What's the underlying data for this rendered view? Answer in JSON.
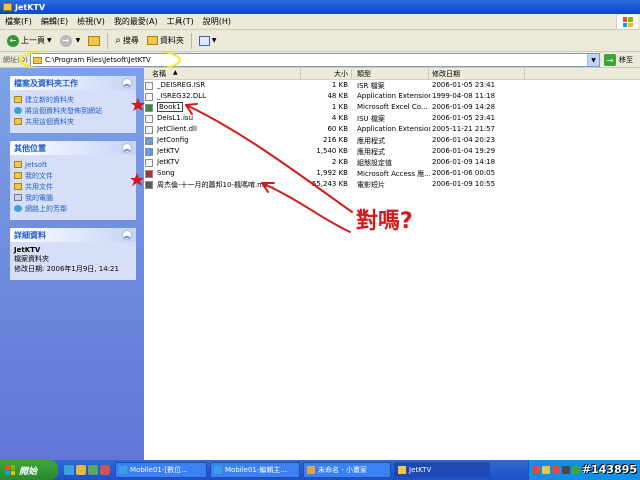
{
  "window": {
    "title": "JetKTV"
  },
  "menu": [
    "檔案(F)",
    "編輯(E)",
    "檢視(V)",
    "我的最愛(A)",
    "工具(T)",
    "說明(H)"
  ],
  "toolbar": {
    "back_label": "上一頁",
    "search_label": "搜尋",
    "folders_label": "資料夾"
  },
  "address": {
    "label": "網址(D)",
    "path": "C:\\Program Files\\Jetsoft\\JetKTV",
    "go_label": "移至"
  },
  "tasks_panel": {
    "title": "檔案及資料夾工作",
    "items": [
      "建立新的資料夾",
      "將這個資料夾發佈到網站",
      "共用這個資料夾"
    ]
  },
  "places_panel": {
    "title": "其他位置",
    "items": [
      "Jetsoft",
      "我的文件",
      "共用文件",
      "我的電腦",
      "網路上的芳鄰"
    ]
  },
  "details_panel": {
    "title": "詳細資料",
    "name": "JetKTV",
    "kind": "檔案資料夾",
    "modified": "修改日期: 2006年1月9日, 14:21"
  },
  "columns": {
    "name": "名稱",
    "size": "大小",
    "type": "類型",
    "date": "修改日期"
  },
  "files": [
    {
      "name": "_DEISREG.ISR",
      "size": "1 KB",
      "type": "ISR 檔案",
      "date": "2006-01-05 23:41"
    },
    {
      "name": "_ISREG32.DLL",
      "size": "48 KB",
      "type": "Application Extension",
      "date": "1999-04-08 11:18"
    },
    {
      "name": "Book1",
      "size": "1 KB",
      "type": "Microsoft Excel Co...",
      "date": "2006-01-09 14:28"
    },
    {
      "name": "DeIsL1.isu",
      "size": "4 KB",
      "type": "ISU 檔案",
      "date": "2006-01-05 23:41"
    },
    {
      "name": "JetClient.dll",
      "size": "60 KB",
      "type": "Application Extension",
      "date": "2005-11-21 21:57"
    },
    {
      "name": "JetConfig",
      "size": "216 KB",
      "type": "應用程式",
      "date": "2006-01-04 20:23"
    },
    {
      "name": "JetKTV",
      "size": "1,540 KB",
      "type": "應用程式",
      "date": "2006-01-04 19:29"
    },
    {
      "name": "JetKTV",
      "size": "2 KB",
      "type": "組態設定值",
      "date": "2006-01-09 14:18"
    },
    {
      "name": "Song",
      "size": "1,992 KB",
      "type": "Microsoft Access 應...",
      "date": "2006-01-06 00:05"
    },
    {
      "name": "周杰倫-十一月的蕭邦10-楓嗎唷.mv...",
      "size": "55,243 KB",
      "type": "電影短片",
      "date": "2006-01-09 10:55"
    }
  ],
  "annotation": {
    "text": "對嗎?"
  },
  "taskbar": {
    "start_label": "開始",
    "tasks": [
      "Mobile01-[數位...",
      "Mobile01-編輯主...",
      "未命名 - 小畫家",
      "JetKTV"
    ],
    "watermark": "#143895"
  }
}
